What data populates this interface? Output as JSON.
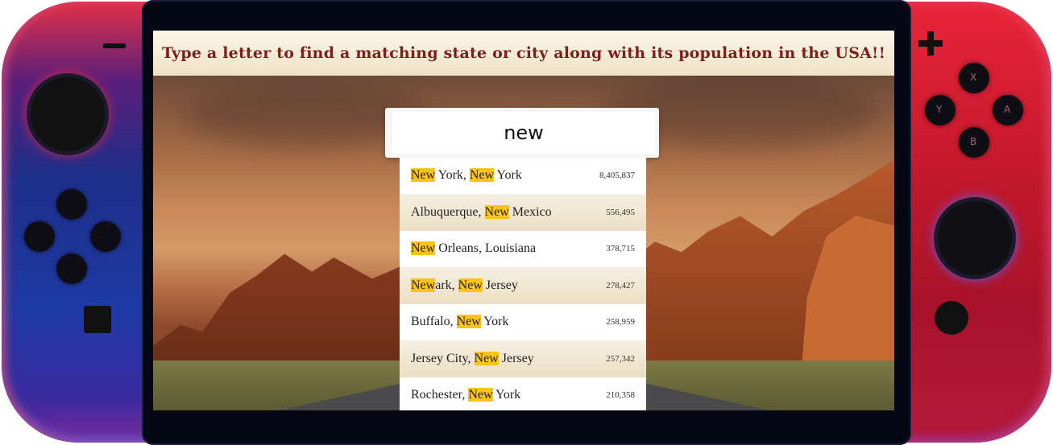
{
  "banner": {
    "title": "Type a letter to find a matching state or city along with its population in the USA!!"
  },
  "search": {
    "value": "new",
    "placeholder": ""
  },
  "results": [
    {
      "parts": [
        {
          "t": "New",
          "h": true
        },
        {
          "t": " York, ",
          "h": false
        },
        {
          "t": "New",
          "h": true
        },
        {
          "t": " York",
          "h": false
        }
      ],
      "population": "8,405,837"
    },
    {
      "parts": [
        {
          "t": "Albuquerque, ",
          "h": false
        },
        {
          "t": "New",
          "h": true
        },
        {
          "t": " Mexico",
          "h": false
        }
      ],
      "population": "556,495"
    },
    {
      "parts": [
        {
          "t": "New",
          "h": true
        },
        {
          "t": " Orleans, Louisiana",
          "h": false
        }
      ],
      "population": "378,715"
    },
    {
      "parts": [
        {
          "t": "New",
          "h": true
        },
        {
          "t": "ark, ",
          "h": false
        },
        {
          "t": "New",
          "h": true
        },
        {
          "t": " Jersey",
          "h": false
        }
      ],
      "population": "278,427"
    },
    {
      "parts": [
        {
          "t": "Buffalo, ",
          "h": false
        },
        {
          "t": "New",
          "h": true
        },
        {
          "t": " York",
          "h": false
        }
      ],
      "population": "258,959"
    },
    {
      "parts": [
        {
          "t": "Jersey City, ",
          "h": false
        },
        {
          "t": "New",
          "h": true
        },
        {
          "t": " Jersey",
          "h": false
        }
      ],
      "population": "257,342"
    },
    {
      "parts": [
        {
          "t": "Rochester, ",
          "h": false
        },
        {
          "t": "New",
          "h": true
        },
        {
          "t": " York",
          "h": false
        }
      ],
      "population": "210,358"
    }
  ],
  "controller": {
    "buttons": {
      "top": "X",
      "left": "Y",
      "right": "A",
      "bottom": "B"
    }
  },
  "colors": {
    "highlight": "#fcc418",
    "title": "#7a1f1a",
    "joycon_left": "#1e3aa5",
    "joycon_right": "#c3182b"
  }
}
